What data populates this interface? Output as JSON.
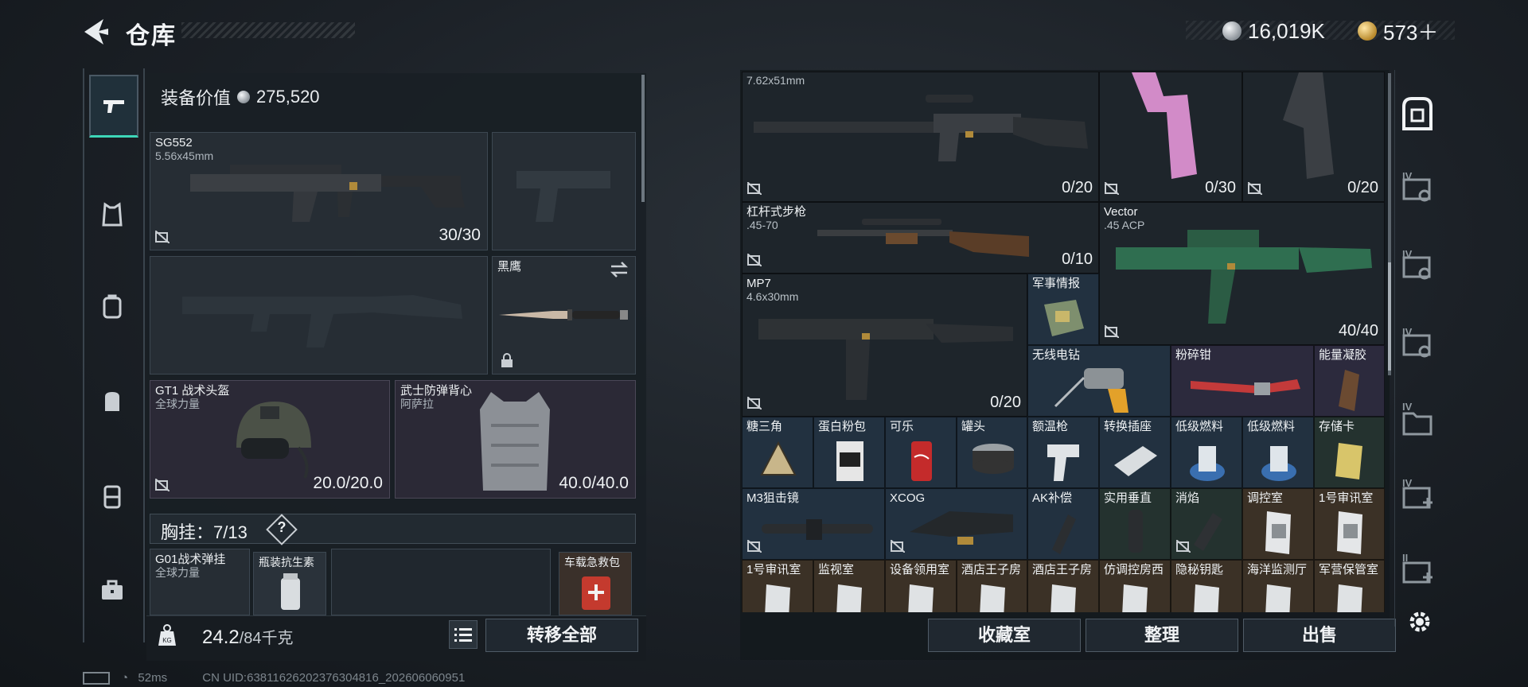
{
  "header": {
    "title": "仓库",
    "currency_primary": "16,019K",
    "currency_secondary": "573＋",
    "primary_coin_icon": "silver-coin-icon",
    "secondary_coin_icon": "gold-coin-icon"
  },
  "sidebar": {
    "tabs": [
      {
        "icon": "pistol-icon",
        "active": true
      },
      {
        "icon": "vest-icon",
        "active": false
      },
      {
        "icon": "backpack-tactical-icon",
        "active": false
      },
      {
        "icon": "backpack-icon",
        "active": false
      },
      {
        "icon": "container-icon",
        "active": false
      },
      {
        "icon": "toolbox-icon",
        "active": false
      }
    ]
  },
  "loadout": {
    "equip_value_label": "装备价值",
    "equip_value": "275,520",
    "primary_weapon": {
      "name": "SG552",
      "caliber": "5.56x45mm",
      "ammo": "30/30"
    },
    "knife": {
      "name": "黑鹰"
    },
    "helmet": {
      "name": "GT1 战术头盔",
      "brand": "全球力量",
      "durability": "20.0/20.0"
    },
    "armor": {
      "name": "武士防弹背心",
      "brand": "阿萨拉",
      "durability": "40.0/40.0"
    },
    "rig_label": "胸挂：",
    "rig_capacity": "7/13",
    "rig_help": "?",
    "rig_items": [
      {
        "name": "G01战术弹挂",
        "sub": "全球力量"
      },
      {
        "name": "瓶装抗生素",
        "sub": ""
      },
      {
        "name": "车载急救包",
        "sub": ""
      }
    ],
    "weight_current": "24.2",
    "weight_max": "/84千克",
    "transfer_all": "转移全部"
  },
  "stash": {
    "items": [
      {
        "name": "",
        "sub": "7.62x51mm",
        "value": "0/20"
      },
      {
        "name": "",
        "sub": "",
        "value": "0/30"
      },
      {
        "name": "",
        "sub": "",
        "value": "0/20"
      },
      {
        "name": "杠杆式步枪",
        "sub": ".45-70",
        "value": "0/10"
      },
      {
        "name": "Vector",
        "sub": ".45 ACP",
        "value": "40/40"
      },
      {
        "name": "MP7",
        "sub": "4.6x30mm",
        "value": "0/20"
      },
      {
        "name": "军事情报"
      },
      {
        "name": "无线电钻"
      },
      {
        "name": "粉碎钳"
      },
      {
        "name": "能量凝胶"
      },
      {
        "name": "糖三角"
      },
      {
        "name": "蛋白粉包"
      },
      {
        "name": "可乐"
      },
      {
        "name": "罐头"
      },
      {
        "name": "额温枪"
      },
      {
        "name": "转换插座"
      },
      {
        "name": "低级燃料"
      },
      {
        "name": "低级燃料"
      },
      {
        "name": "存储卡"
      },
      {
        "name": "M3狙击镜"
      },
      {
        "name": "XCOG"
      },
      {
        "name": "AK补偿"
      },
      {
        "name": "实用垂直"
      },
      {
        "name": "消焰"
      },
      {
        "name": "调控室"
      },
      {
        "name": "1号审讯室"
      },
      {
        "name": "1号审讯室"
      },
      {
        "name": "监视室"
      },
      {
        "name": "设备领用室"
      },
      {
        "name": "酒店王子房"
      },
      {
        "name": "酒店王子房"
      },
      {
        "name": "仿调控房西"
      },
      {
        "name": "隐秘钥匙"
      },
      {
        "name": "海洋监测厅"
      },
      {
        "name": "军营保管室"
      }
    ],
    "buttons": {
      "collection": "收藏室",
      "sort": "整理",
      "sell": "出售"
    }
  },
  "right_sidebar": {
    "tabs": [
      "safe-box-icon",
      "case-iv-icon",
      "case-iv-icon",
      "case-iv-icon",
      "folder-iv-icon",
      "case-iv-plus-icon",
      "case-ii-plus-icon"
    ],
    "labels": [
      "IV",
      "IV",
      "IV",
      "IV",
      "IV",
      "II"
    ]
  },
  "status": {
    "ping": "52ms",
    "uid": "CN UID:63811626202376304816_202606060951"
  },
  "colors": {
    "accent": "#3dd6b8",
    "gold": "#b98a2c",
    "purple_slot": "#2c2a3d",
    "blue_slot": "#223140",
    "green_slot": "#24322f"
  }
}
